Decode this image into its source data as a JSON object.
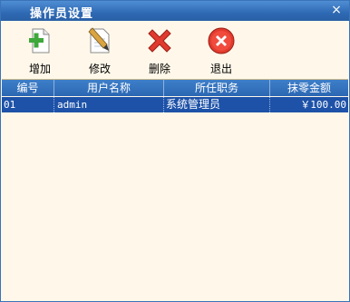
{
  "window": {
    "title": "操作员设置",
    "close_glyph": "×"
  },
  "toolbar": {
    "add_label": "增加",
    "edit_label": "修改",
    "delete_label": "删除",
    "exit_label": "退出"
  },
  "table": {
    "columns": [
      "编号",
      "用户名称",
      "所任职务",
      "抹零金额"
    ],
    "rows": [
      {
        "id": "01",
        "username": "admin",
        "position": "系统管理员",
        "rounding_amount": "￥100.00"
      }
    ]
  },
  "colors": {
    "accent": "#2f6ab4",
    "selection": "#1d52a8",
    "background": "#fff8ea",
    "delete_red": "#e03a2f"
  }
}
